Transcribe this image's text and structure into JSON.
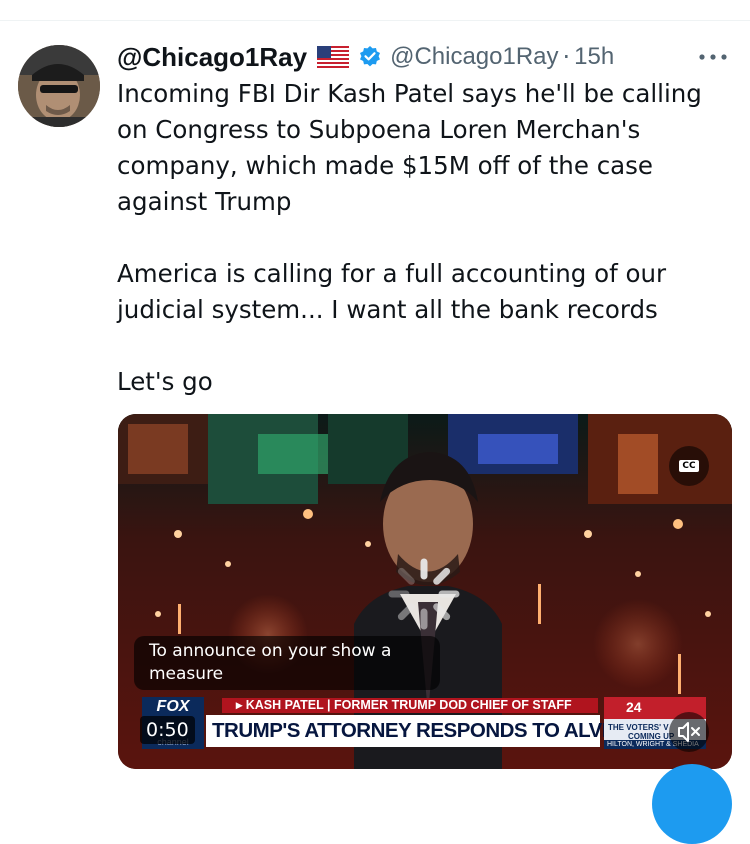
{
  "tweet": {
    "display_name": "@Chicago1Ray",
    "handle": "@Chicago1Ray",
    "separator": "·",
    "time": "15h",
    "paragraph1_lines": [
      "Incoming FBI Dir Kash Patel says he'll be calling",
      "on Congress to Subpoena Loren Merchan's",
      "company, which made $15M off of the case",
      "against Trump"
    ],
    "paragraph2_lines": [
      "America is calling for a full accounting of our",
      "judicial system... I want all the bank records"
    ],
    "paragraph3": "Let's go"
  },
  "video": {
    "cc_label": "CC",
    "caption_lines": [
      "To announce on your show a",
      "measure"
    ],
    "name_strip": "▸ KASH PATEL | FORMER TRUMP DOD CHIEF OF STAFF",
    "headline": "TRUMP'S ATTORNEY RESPONDS TO ALVIN BRAGG",
    "network_logo": "FOX",
    "network_sub": "channel",
    "timestamp": "0:50",
    "promo_year": "24",
    "promo_line1": "THE VOTERS' V",
    "promo_line2": "COMING UP",
    "promo_bar": "HILTON, WRIGHT & SHEDIA"
  },
  "colors": {
    "verified_blue": "#1d9bf0",
    "handle_gray": "#536471",
    "fox_red": "#b0141e",
    "fox_navy": "#0b2a5b"
  }
}
